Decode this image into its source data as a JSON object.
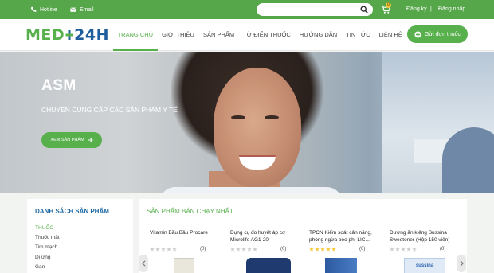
{
  "topbar": {
    "hotline_label": "Hotline",
    "email_label": "Email",
    "search": {
      "placeholder": "",
      "value": ""
    },
    "cart_count": "0",
    "register_label": "Đăng ký",
    "login_label": "Đăng nhập",
    "separator": "|"
  },
  "nav": {
    "logo_part1": "MED",
    "logo_part2": "24H",
    "items": [
      {
        "label": "TRANG CHỦ",
        "active": true
      },
      {
        "label": "GIỚI THIỆU",
        "active": false
      },
      {
        "label": "SẢN PHẨM",
        "active": false
      },
      {
        "label": "TỪ ĐIỂN THUỐC",
        "active": false
      },
      {
        "label": "HƯỚNG DẪN",
        "active": false
      },
      {
        "label": "TIN TỨC",
        "active": false
      },
      {
        "label": "LIÊN HỆ",
        "active": false
      }
    ],
    "order_button": "Gửi đơn thuốc"
  },
  "hero": {
    "title": "ASM",
    "subtitle": "CHUYÊN CUNG CẤP CÁC SẢN PHẨM Y TẾ",
    "button": "XEM SẢN PHẨM"
  },
  "categories": {
    "title": "DANH SÁCH SẢN PHẨM",
    "items": [
      "THUỐC",
      "Thuốc mắt",
      "Tim mạch",
      "Dị ứng",
      "Gan"
    ]
  },
  "bestsellers": {
    "title": "SẢN PHẨM BÁN CHẠY NHẤT",
    "products": [
      {
        "name": "Vitamin Bầu Bầu Procare",
        "rating": 0,
        "count": "(0)"
      },
      {
        "name": "Dụng cụ đo huyết áp cơ Microlife AG1-20",
        "rating": 0,
        "count": "(0)"
      },
      {
        "name": "TPCN Kiểm soát cân nặng, phòng ngừa béo phì LIC...",
        "rating": 5,
        "count": "(0)"
      },
      {
        "name": "Đường ăn kiêng Sussina Sweetener (Hộp 150 viên)",
        "rating": 0,
        "count": "(0)"
      }
    ],
    "product_image_text": "sussina"
  },
  "colors": {
    "green": "#58b04d",
    "blue": "#1f6aa5",
    "star": "#f4c531"
  }
}
